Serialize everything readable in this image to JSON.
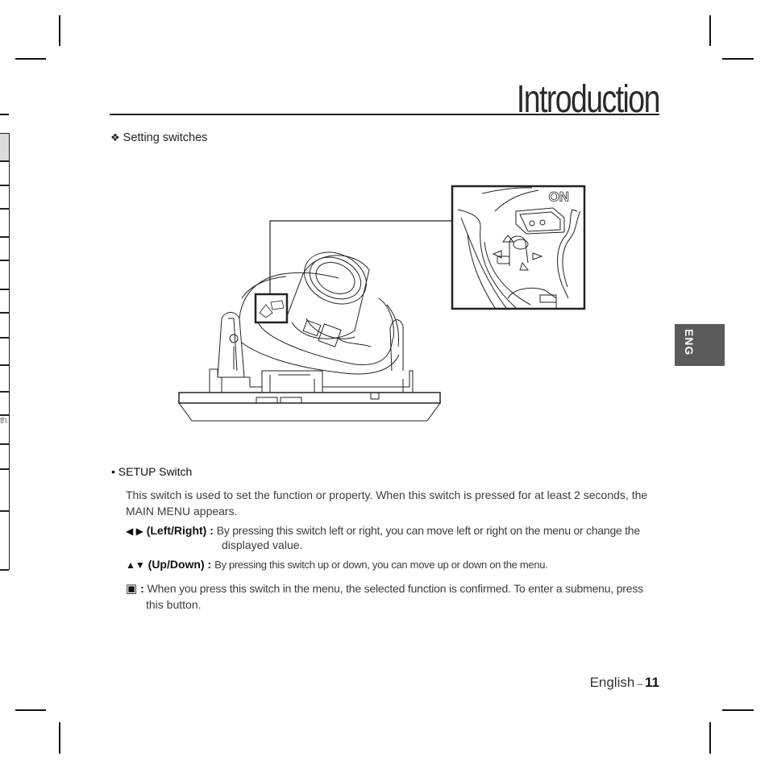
{
  "header": {
    "title": "Introduction"
  },
  "section": {
    "bullet_icon": "diamond-bullet-icon",
    "heading": "Setting switches"
  },
  "side_tab": {
    "label": "ENG",
    "color": "#5a5a5a"
  },
  "left_tabs": {
    "fragment_text": "th"
  },
  "figure": {
    "description": "Dome camera with setup switch callout",
    "callout_icon": "setup-switch-closeup"
  },
  "setup": {
    "heading": "SETUP Switch",
    "intro": "This switch is used to set the function or property. When this switch is pressed for at least 2 seconds, the MAIN MENU appears.",
    "items": [
      {
        "icon": "left-right-arrows-icon",
        "glyph": "◀ ▶",
        "label": "(Left/Right) :",
        "text": "By pressing this switch left or right, you can move left or right on the menu or change the",
        "text_cont": "displayed value."
      },
      {
        "icon": "up-down-arrows-icon",
        "glyph": "▲▼",
        "label": "(Up/Down) :",
        "text": "By pressing this switch up or down, you can move up or down on the menu."
      },
      {
        "icon": "enter-button-icon",
        "glyph": "▣",
        "label": ":",
        "text": "When you press this switch in the menu, the selected function is confirmed. To enter a submenu, press",
        "text_cont": "this button."
      }
    ]
  },
  "footer": {
    "language": "English",
    "separator": "–",
    "page_number": "11"
  }
}
